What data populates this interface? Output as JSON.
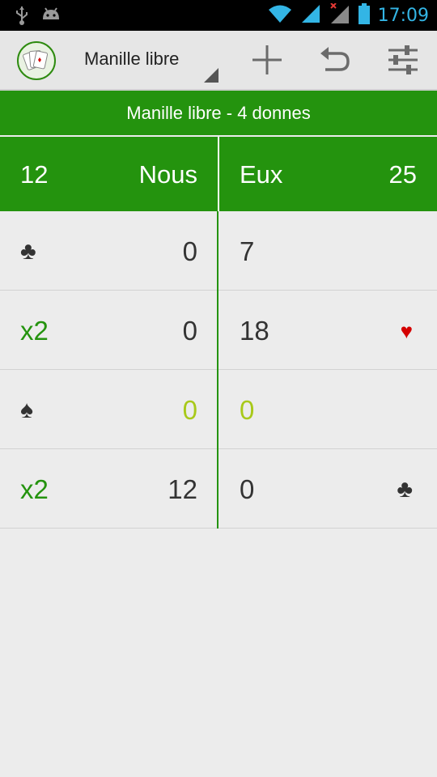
{
  "status_bar": {
    "time": "17:09",
    "icons": [
      "usb-icon",
      "android-debug-icon",
      "wifi-icon",
      "signal-icon",
      "signal-no-data-icon",
      "battery-icon"
    ]
  },
  "action_bar": {
    "title": "Manille libre",
    "actions": [
      "add-icon",
      "undo-icon",
      "settings-sliders-icon"
    ]
  },
  "game": {
    "title": "Manille libre - 4 donnes",
    "team_nous": {
      "label": "Nous",
      "total": "12"
    },
    "team_eux": {
      "label": "Eux",
      "total": "25"
    }
  },
  "rounds": [
    {
      "left_mark": "♣",
      "left_mark_type": "suit-clubs",
      "nous": "0",
      "eux": "7",
      "right_mark": "",
      "right_mark_type": ""
    },
    {
      "left_mark": "x2",
      "left_mark_type": "multiplier",
      "nous": "0",
      "eux": "18",
      "right_mark": "♥",
      "right_mark_type": "suit-hearts"
    },
    {
      "left_mark": "♠",
      "left_mark_type": "suit-spades",
      "nous": "0",
      "eux": "0",
      "right_mark": "",
      "right_mark_type": "",
      "draw": true
    },
    {
      "left_mark": "x2",
      "left_mark_type": "multiplier",
      "nous": "12",
      "eux": "0",
      "right_mark": "♣",
      "right_mark_type": "suit-clubs"
    }
  ],
  "colors": {
    "accent_green": "#24930e",
    "draw_green": "#a8c91a",
    "heart_red": "#d40000",
    "status_blue": "#33b5e5"
  }
}
